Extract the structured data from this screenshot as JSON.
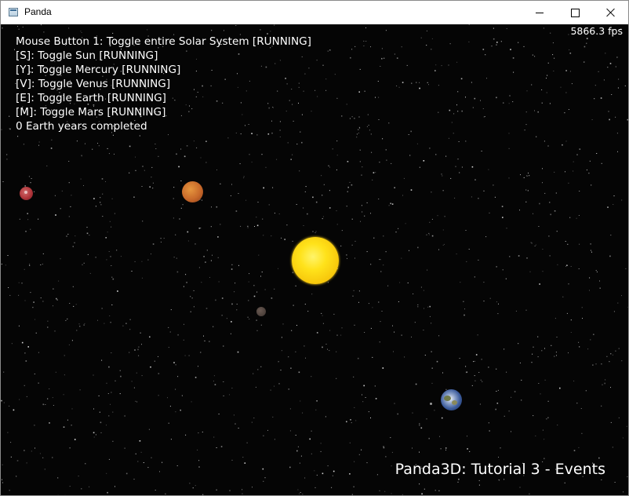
{
  "window": {
    "title": "Panda"
  },
  "fps": "5866.3 fps",
  "hud": {
    "lines": [
      "Mouse Button 1: Toggle entire Solar System [RUNNING]",
      "[S]: Toggle Sun [RUNNING]",
      "[Y]: Toggle Mercury [RUNNING]",
      "[V]: Toggle Venus [RUNNING]",
      "[E]: Toggle Earth [RUNNING]",
      "[M]: Toggle Mars [RUNNING]",
      "0 Earth years completed"
    ]
  },
  "tutorial_title": "Panda3D: Tutorial 3 - Events",
  "colors": {
    "background": "#050505",
    "sun": "#ffe21a",
    "venus": "#c8692a",
    "mars": "#b0353a",
    "earth": "#3a5a9a",
    "mercury": "#4e423c",
    "text": "#ffffff"
  },
  "icons": {
    "app": "panda-window-icon",
    "minimize": "minimize-icon",
    "maximize": "maximize-icon",
    "close": "close-icon"
  }
}
